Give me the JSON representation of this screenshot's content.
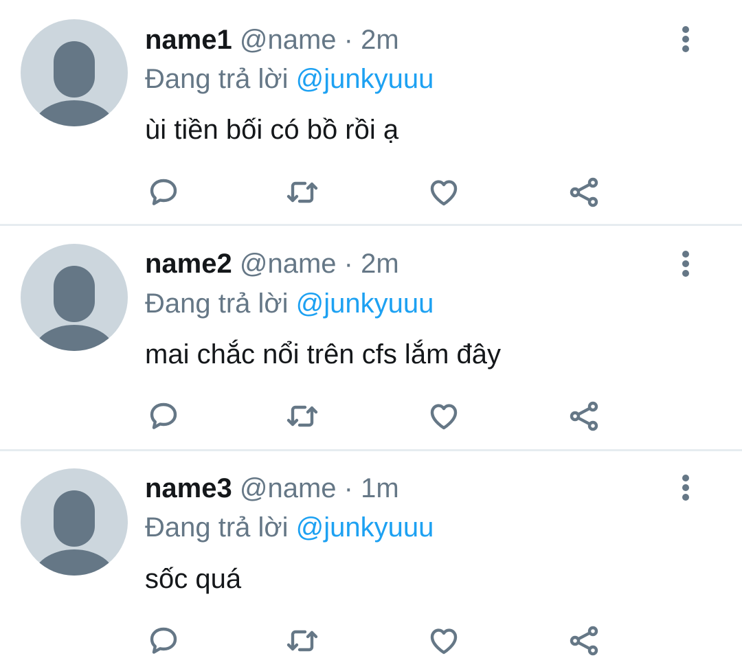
{
  "tweets": [
    {
      "name": "name1",
      "handle": "@name",
      "separator": "·",
      "time": "2m",
      "reply_prefix": "Đang trả lời",
      "reply_to": "@junkyuuu",
      "text": "ùi tiền bối có bồ rồi ạ"
    },
    {
      "name": "name2",
      "handle": "@name",
      "separator": "·",
      "time": "2m",
      "reply_prefix": "Đang trả lời",
      "reply_to": "@junkyuuu",
      "text": "mai chắc nổi trên cfs lắm đây"
    },
    {
      "name": "name3",
      "handle": "@name",
      "separator": "·",
      "time": "1m",
      "reply_prefix": "Đang trả lời",
      "reply_to": "@junkyuuu",
      "text": "sốc quá"
    }
  ],
  "icons": {
    "avatar": "default-avatar-icon",
    "more": "more-vertical-icon",
    "reply": "reply-icon",
    "retweet": "retweet-icon",
    "like": "heart-icon",
    "share": "share-icon"
  },
  "colors": {
    "primary_text": "#14171a",
    "secondary_text": "#657786",
    "mention": "#1da1f2",
    "avatar_bg": "#ccd6dd",
    "avatar_fg": "#657786",
    "divider": "#e6ecf0"
  }
}
